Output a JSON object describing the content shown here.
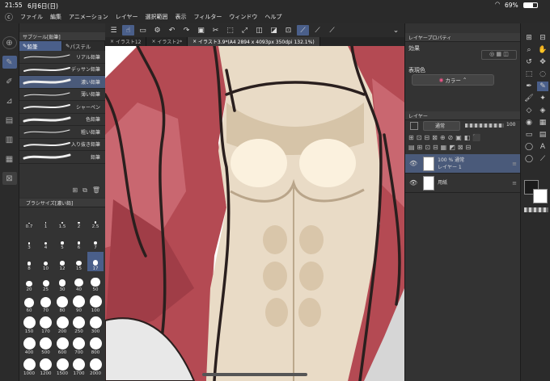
{
  "status": {
    "time": "21:55",
    "date": "6月6日(日)",
    "battery": "69%"
  },
  "menu": [
    "ファイル",
    "編集",
    "アニメーション",
    "レイヤー",
    "選択範囲",
    "表示",
    "フィルター",
    "ウィンドウ",
    "ヘルプ"
  ],
  "subtool": {
    "title": "サブツール[鉛筆]",
    "tabs": [
      "鉛筆",
      "パステル"
    ],
    "brushes": [
      "リアル鉛筆",
      "デッサン鉛筆",
      "濃い鉛筆",
      "薄い鉛筆",
      "シャーペン",
      "色鉛筆",
      "粗い鉛筆",
      "入り抜き鉛筆",
      "鉛筆"
    ],
    "selected_index": 2
  },
  "brushsize": {
    "title": "ブラシサイズ[濃い鉛]",
    "sizes": [
      "0.7",
      "1",
      "1.5",
      "2",
      "2.5",
      "3",
      "4",
      "5",
      "6",
      "7",
      "8",
      "10",
      "12",
      "15",
      "17",
      "20",
      "25",
      "30",
      "40",
      "50",
      "60",
      "70",
      "80",
      "90",
      "100",
      "150",
      "170",
      "200",
      "250",
      "300",
      "400",
      "500",
      "600",
      "700",
      "800",
      "1000",
      "1200",
      "1500",
      "1700",
      "2000"
    ],
    "selected": "17"
  },
  "doc": {
    "tabs": [
      "イラスト12",
      "イラスト2*",
      "イラスト3.9*(A4 2894 x 4093px 350dpi 132.1%)"
    ]
  },
  "layerprop": {
    "title": "レイヤープロパティ",
    "effect_label": "効果",
    "expr_label": "表現色",
    "expr_value": "カラー"
  },
  "layers": {
    "title": "レイヤー",
    "blend": "通常",
    "opacity": "100",
    "items": [
      {
        "line1": "100 % 通常",
        "line2": "レイヤー 1"
      },
      {
        "line1": "",
        "line2": "用紙"
      }
    ]
  },
  "colors": {
    "accent": "#4a5f8a",
    "main": "#1a1a1a",
    "sub": "#ffffff"
  }
}
